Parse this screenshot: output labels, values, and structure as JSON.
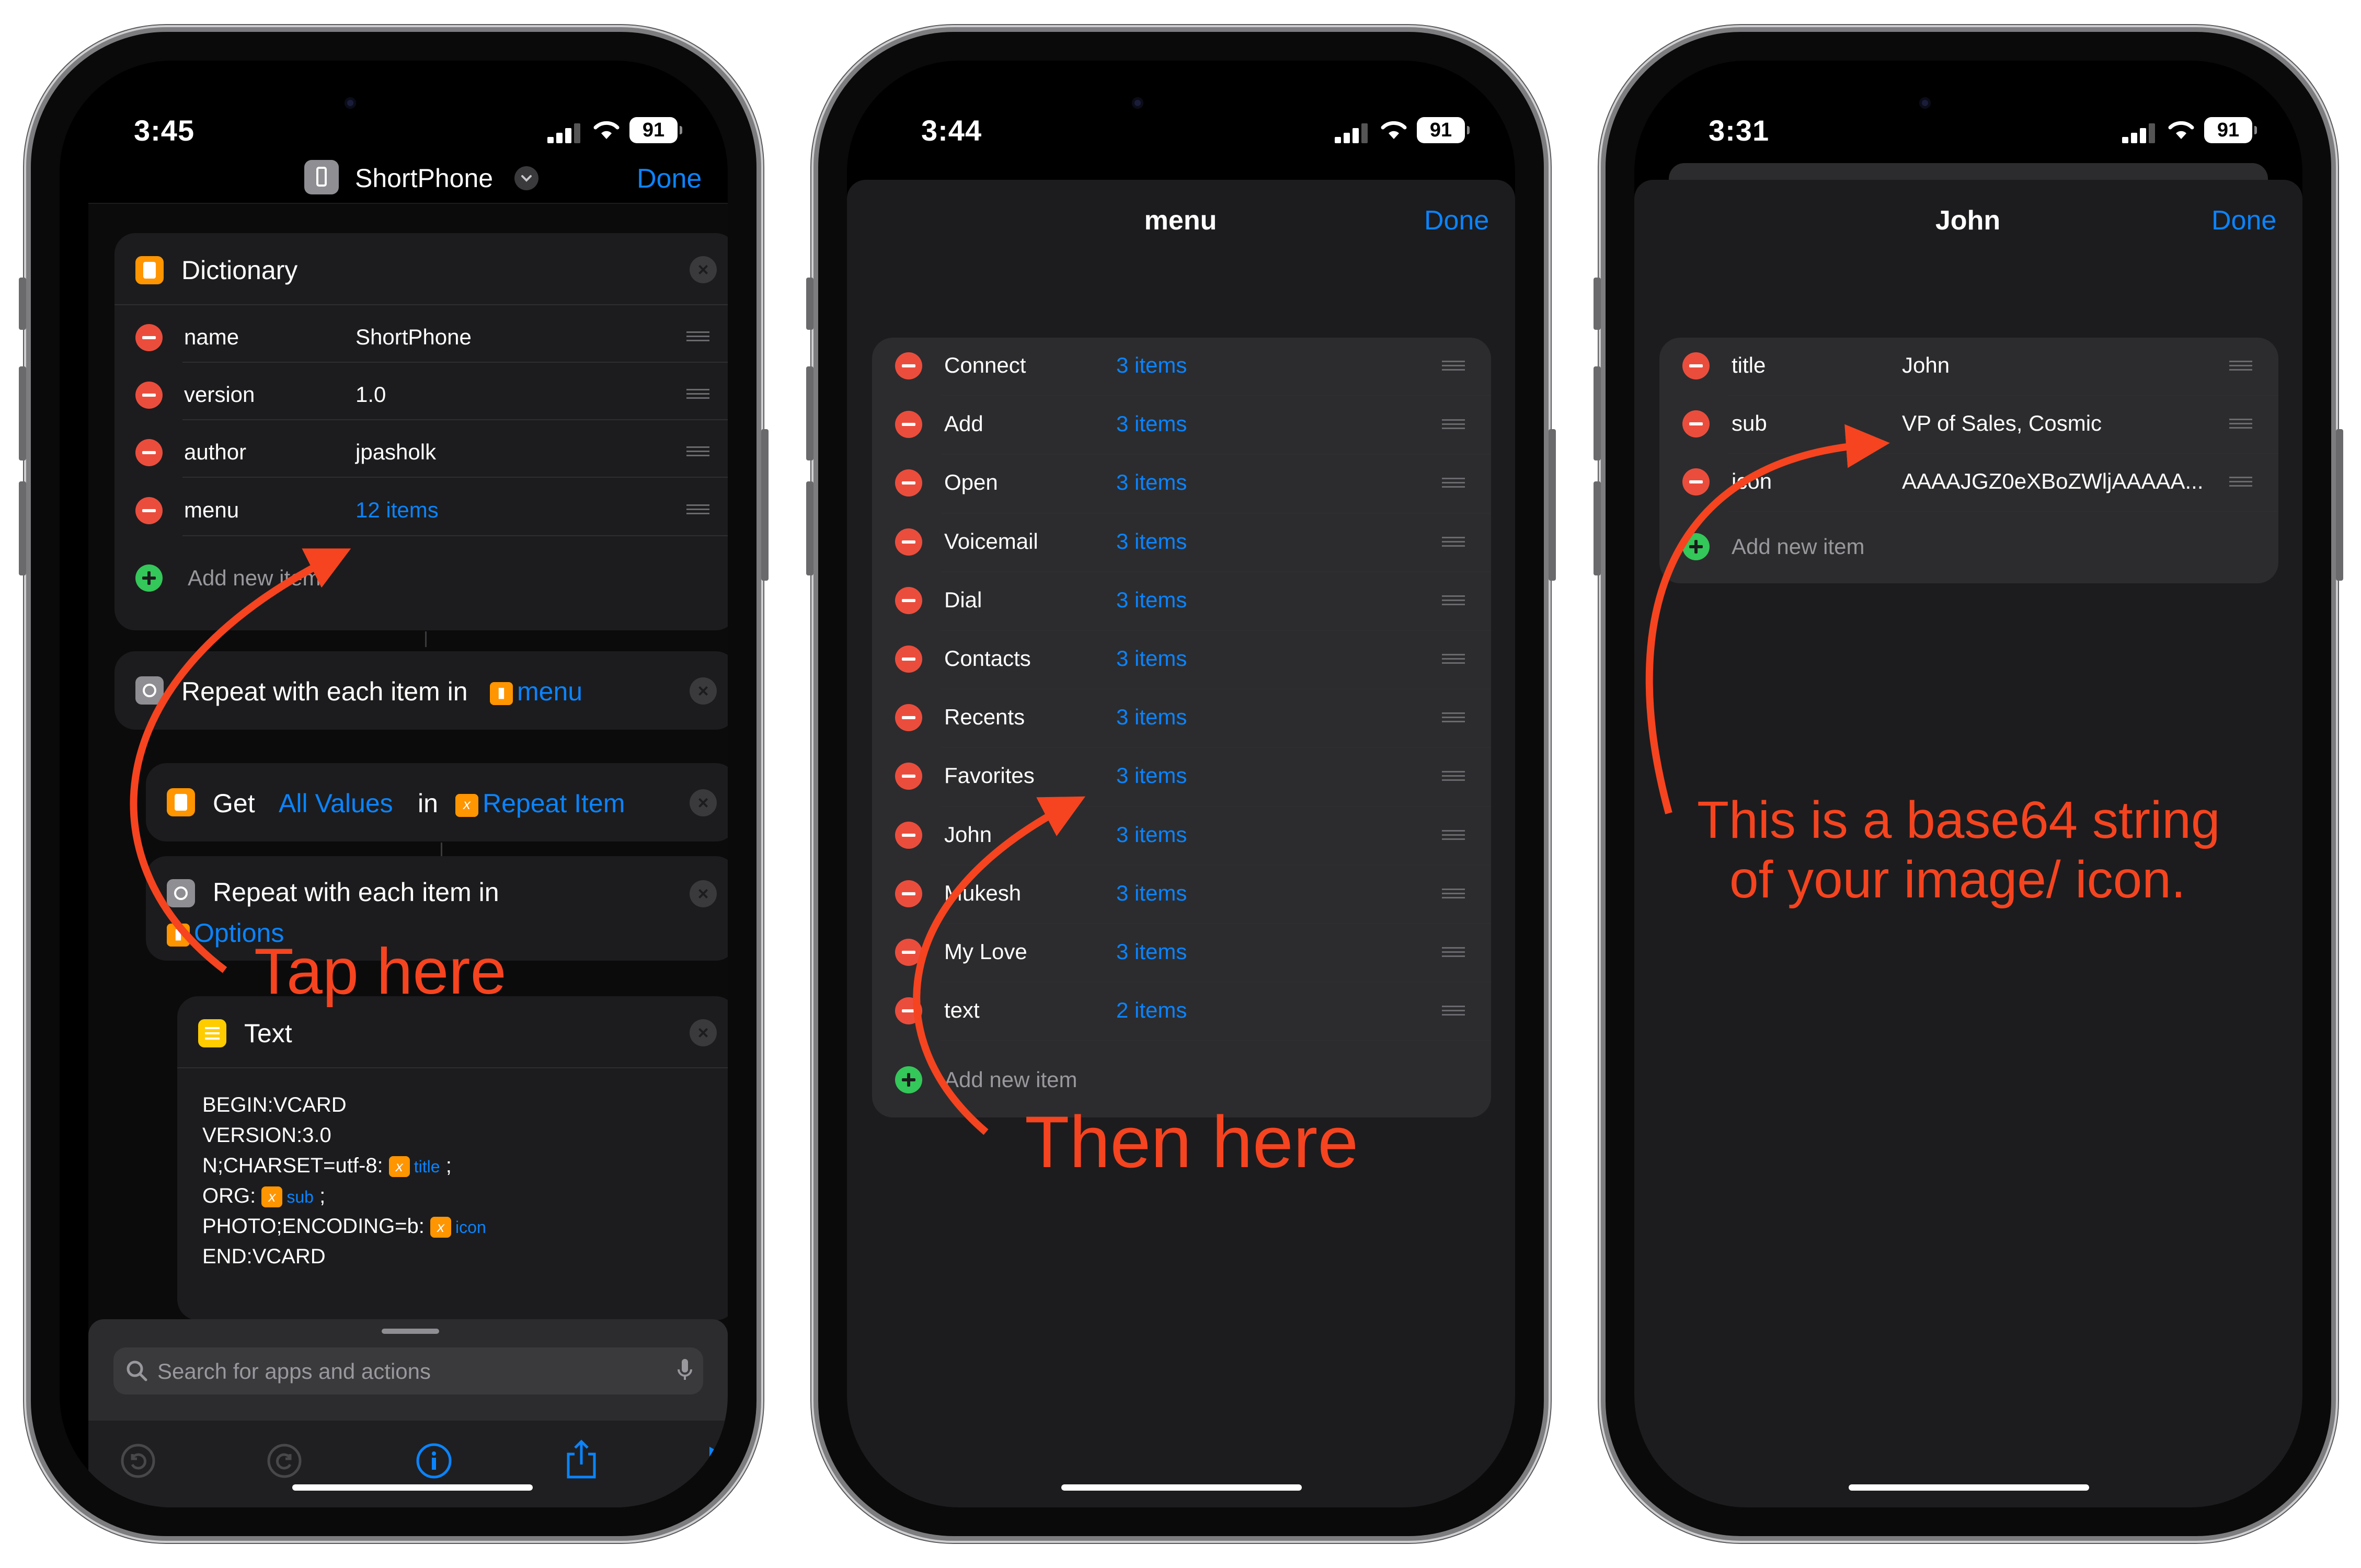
{
  "colors": {
    "accent": "#0a84ff",
    "annotation": "#f5441f",
    "delete": "#eb4d3d",
    "add": "#34c759",
    "variable": "#ff9500"
  },
  "status": {
    "p1_time": "3:45",
    "p2_time": "3:44",
    "p3_time": "3:31",
    "battery": "91"
  },
  "p1": {
    "title": "ShortPhone",
    "done": "Done",
    "dict": {
      "title": "Dictionary",
      "rows": [
        {
          "key": "name",
          "value": "ShortPhone"
        },
        {
          "key": "version",
          "value": "1.0"
        },
        {
          "key": "author",
          "value": "jpasholk"
        },
        {
          "key": "menu",
          "value": "12 items"
        }
      ],
      "add": "Add new item"
    },
    "repeat1": {
      "label": "Repeat with each item in",
      "var": "menu"
    },
    "get": {
      "label": "Get",
      "values": "All Values",
      "in": "in",
      "var": "Repeat Item"
    },
    "repeat2": {
      "label": "Repeat with each item in",
      "var": "Options"
    },
    "text": {
      "title": "Text",
      "l1": "BEGIN:VCARD",
      "l2": "VERSION:3.0",
      "l3": "N;CHARSET=utf-8:",
      "v3": "title",
      "l4": "ORG:",
      "v4": "sub",
      "l5": "PHOTO;ENCODING=b:",
      "v5": "icon",
      "l6": "END:VCARD",
      "semi": ";"
    },
    "search": {
      "placeholder": "Search for apps and actions"
    }
  },
  "p2": {
    "title": "menu",
    "done": "Done",
    "rows": [
      {
        "key": "Connect",
        "value": "3 items"
      },
      {
        "key": "Add",
        "value": "3 items"
      },
      {
        "key": "Open",
        "value": "3 items"
      },
      {
        "key": "Voicemail",
        "value": "3 items"
      },
      {
        "key": "Dial",
        "value": "3 items"
      },
      {
        "key": "Contacts",
        "value": "3 items"
      },
      {
        "key": "Recents",
        "value": "3 items"
      },
      {
        "key": "Favorites",
        "value": "3 items"
      },
      {
        "key": "John",
        "value": "3 items"
      },
      {
        "key": "Mukesh",
        "value": "3 items"
      },
      {
        "key": "My Love",
        "value": "3 items"
      },
      {
        "key": "text",
        "value": "2 items"
      }
    ],
    "add": "Add new item"
  },
  "p3": {
    "title": "John",
    "done": "Done",
    "rows": [
      {
        "key": "title",
        "value": "John"
      },
      {
        "key": "sub",
        "value": "VP of Sales, Cosmic"
      },
      {
        "key": "icon",
        "value": "AAAAJGZ0eXBoZWljAAAAA..."
      }
    ],
    "add": "Add new item"
  },
  "annotations": {
    "tap": "Tap here",
    "then": "Then here",
    "base64_l1": "This is a base64 string",
    "base64_l2": "of your image/ icon."
  },
  "icons": {
    "shortcut": "phone-shortcut-icon",
    "dictionary": "dictionary-icon",
    "repeat": "repeat-icon",
    "get": "get-dictionary-value-icon",
    "text": "text-icon",
    "search": "search-icon",
    "mic": "microphone-icon",
    "undo": "undo-icon",
    "redo": "redo-icon",
    "info": "info-icon",
    "share": "share-icon",
    "play": "play-icon"
  }
}
